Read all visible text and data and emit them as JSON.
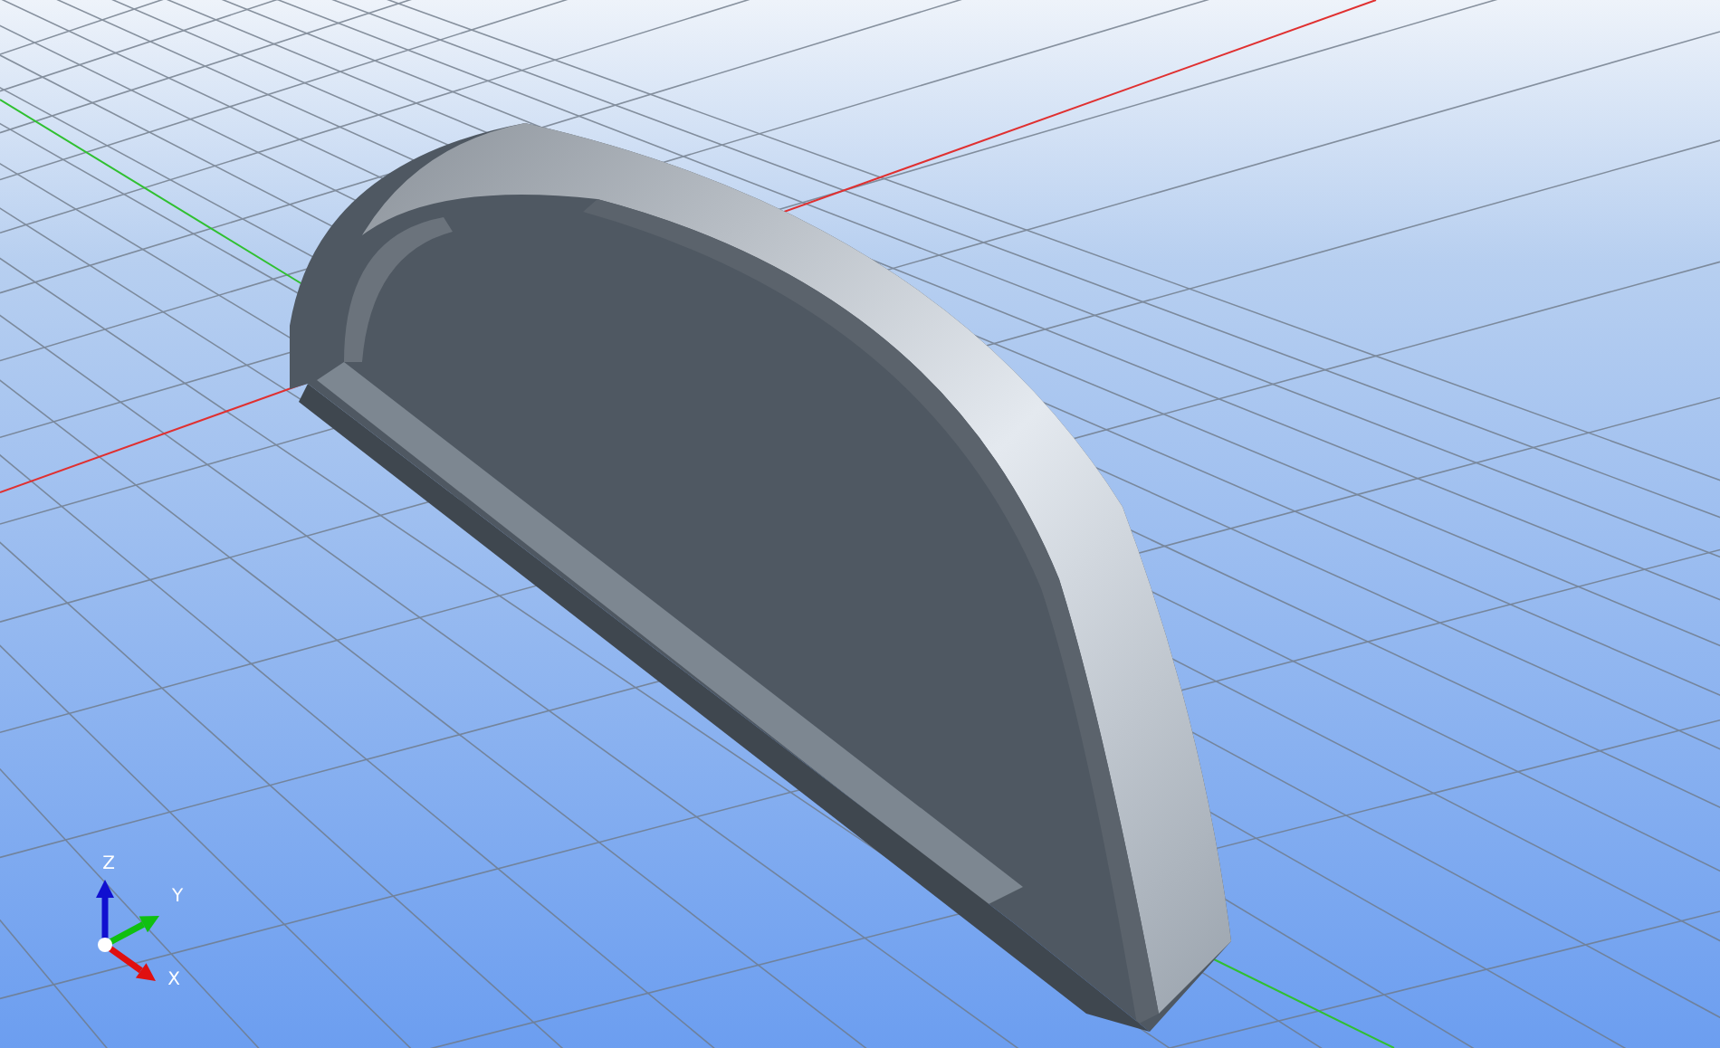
{
  "viewport": {
    "axis_labels": [
      {
        "kind": "z",
        "label": "Z"
      },
      {
        "kind": "y",
        "label": "Y"
      },
      {
        "kind": "x",
        "label": "X"
      }
    ]
  }
}
